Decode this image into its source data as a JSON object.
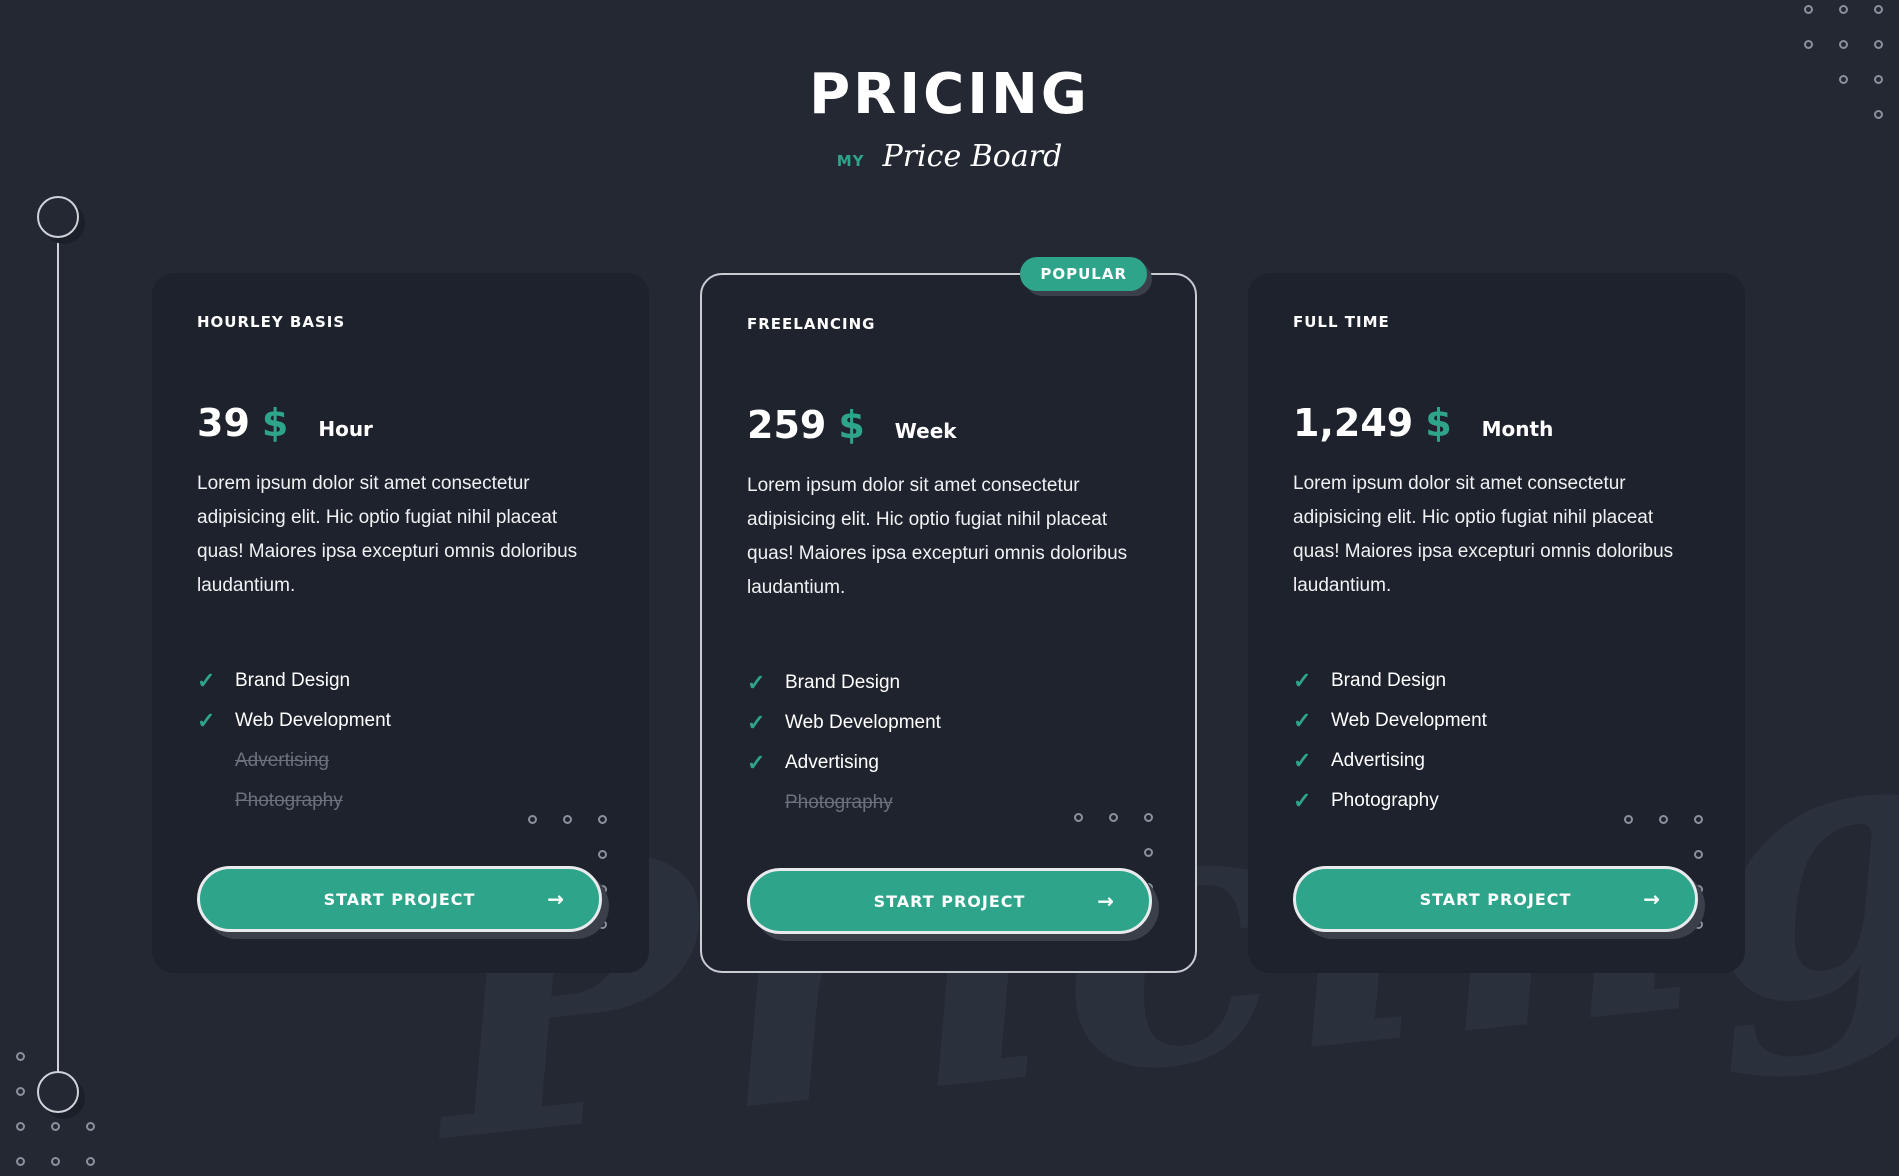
{
  "header": {
    "title": "PRICING",
    "subtitle_small": "MY",
    "subtitle_script": "Price Board"
  },
  "watermark": "Pricing",
  "colors": {
    "accent": "#2ea58a",
    "background": "#232833",
    "card": "#1e222c"
  },
  "plans": [
    {
      "name": "HOURLEY BASIS",
      "price": "39",
      "currency": "$",
      "period": "Hour",
      "description": "Lorem ipsum dolor sit amet consectetur adipisicing elit. Hic optio fugiat nihil placeat quas! Maiores ipsa excepturi omnis doloribus laudantium.",
      "features": [
        {
          "label": "Brand Design",
          "included": true
        },
        {
          "label": "Web Development",
          "included": true
        },
        {
          "label": "Advertising",
          "included": false
        },
        {
          "label": "Photography",
          "included": false
        }
      ],
      "button": "START PROJECT"
    },
    {
      "name": "FREELANCING",
      "badge": "POPULAR",
      "price": "259",
      "currency": "$",
      "period": "Week",
      "description": "Lorem ipsum dolor sit amet consectetur adipisicing elit. Hic optio fugiat nihil placeat quas! Maiores ipsa excepturi omnis doloribus laudantium.",
      "features": [
        {
          "label": "Brand Design",
          "included": true
        },
        {
          "label": "Web Development",
          "included": true
        },
        {
          "label": "Advertising",
          "included": true
        },
        {
          "label": "Photography",
          "included": false
        }
      ],
      "button": "START PROJECT"
    },
    {
      "name": "FULL TIME",
      "price": "1,249",
      "currency": "$",
      "period": "Month",
      "description": "Lorem ipsum dolor sit amet consectetur adipisicing elit. Hic optio fugiat nihil placeat quas! Maiores ipsa excepturi omnis doloribus laudantium.",
      "features": [
        {
          "label": "Brand Design",
          "included": true
        },
        {
          "label": "Web Development",
          "included": true
        },
        {
          "label": "Advertising",
          "included": true
        },
        {
          "label": "Photography",
          "included": true
        }
      ],
      "button": "START PROJECT"
    }
  ],
  "icons": {
    "check": "check-icon",
    "arrow": "arrow-right-icon"
  }
}
